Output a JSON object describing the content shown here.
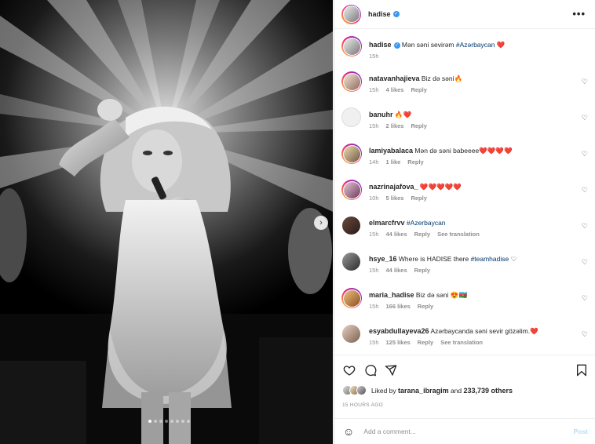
{
  "post": {
    "author": "hadise",
    "caption_text": "Mən səni sevirəm",
    "caption_tag": "#Azərbaycan",
    "caption_emoji": "❤️",
    "caption_time": "15h",
    "more_icon": "•••"
  },
  "media": {
    "next_icon": "›",
    "slide_count": 8,
    "active_slide": 0
  },
  "comments": [
    {
      "user": "natavanhajieva",
      "text": "Biz də səni",
      "emoji": "🔥",
      "time": "15h",
      "likes": "4 likes",
      "reply": "Reply",
      "translation": ""
    },
    {
      "user": "banuhr",
      "text": "",
      "emoji": "🔥❤️",
      "time": "15h",
      "likes": "2 likes",
      "reply": "Reply",
      "translation": ""
    },
    {
      "user": "lamiyabalaca",
      "text": "Mən də səni babeeee",
      "emoji": "❤️❤️❤️❤️",
      "time": "14h",
      "likes": "1 like",
      "reply": "Reply",
      "translation": ""
    },
    {
      "user": "nazrinajafova_",
      "text": "",
      "emoji": "❤️❤️❤️❤️❤️",
      "time": "10h",
      "likes": "5 likes",
      "reply": "Reply",
      "translation": ""
    },
    {
      "user": "elmarcfrvv",
      "text": "",
      "tag": "#Azerbaycan",
      "emoji": "",
      "time": "15h",
      "likes": "44 likes",
      "reply": "Reply",
      "translation": "See translation"
    },
    {
      "user": "hsye_16",
      "text": "Where is HADISE there",
      "tag": "#teamhadise",
      "emoji": "♡",
      "time": "15h",
      "likes": "44 likes",
      "reply": "Reply",
      "translation": ""
    },
    {
      "user": "maria_hadise",
      "text": "Biz də səni",
      "emoji": "😍🇦🇿",
      "time": "15h",
      "likes": "166 likes",
      "reply": "Reply",
      "translation": ""
    },
    {
      "user": "esyabdullayeva26",
      "text": "Azərbaycanda səni sevir gözəlim.",
      "emoji": "❤️",
      "time": "15h",
      "likes": "125 likes",
      "reply": "Reply",
      "translation": "See translation"
    }
  ],
  "like_icon": "♡",
  "likes_summary": {
    "prefix": "Liked by",
    "user": "tarana_ibragim",
    "and": "and",
    "count": "233,739 others"
  },
  "time_ago": "15 HOURS AGO",
  "add_comment": {
    "placeholder": "Add a comment...",
    "post_label": "Post",
    "emoji_icon": "☺"
  },
  "colors": {
    "link": "#00376b",
    "muted": "#8e8e8e",
    "post_disabled": "#b2dffc",
    "verified": "#3897f0",
    "heart": "#ed4956"
  }
}
